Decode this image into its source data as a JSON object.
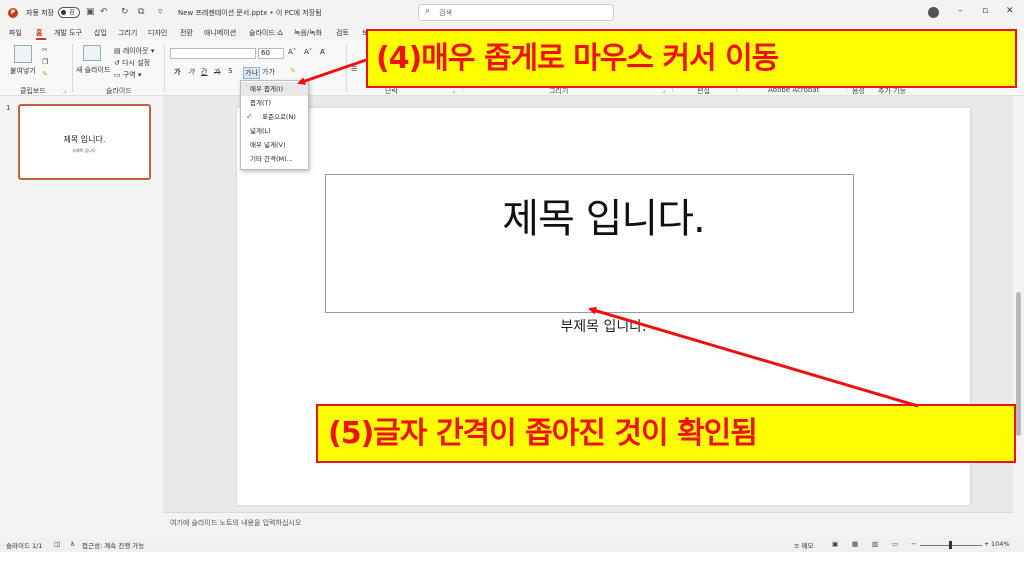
{
  "titlebar": {
    "autosave_label": "자동 저장",
    "toggle_state": "끔",
    "document_title": "New 프레젠테이션 문서.pptx • 이 PC에 저장됨",
    "search_placeholder": "검색"
  },
  "menu": {
    "tabs": [
      "파일",
      "홈",
      "개발 도구",
      "삽입",
      "그리기",
      "디자인",
      "전환",
      "애니메이션",
      "슬라이드 쇼",
      "녹음/녹화",
      "검토",
      "보"
    ],
    "active_tab": "홈"
  },
  "ribbon": {
    "paste_label": "붙여넣기",
    "new_slide_label": "새 슬라이드",
    "layout_label": "레이아웃",
    "reset_label": "다시 설정",
    "section_label": "구역",
    "clipboard_group": "클립보드",
    "slides_group": "슬라이드",
    "font_size": "60",
    "paragraph_group": "단락",
    "drawing_group": "그리기",
    "editing_group": "편집",
    "acrobat_group": "Adobe Acrobat",
    "voice_group": "음성",
    "addins_group": "추가 기능",
    "spacing_button": "가나"
  },
  "spacing_menu": {
    "items": [
      {
        "label": "매우 좁게(I)",
        "checked": false,
        "hover": true
      },
      {
        "label": "좁게(T)",
        "checked": false,
        "hover": false
      },
      {
        "label": "표준으로(N)",
        "checked": true,
        "hover": false
      },
      {
        "label": "넓게(L)",
        "checked": false,
        "hover": false
      },
      {
        "label": "매우 넓게(V)",
        "checked": false,
        "hover": false
      },
      {
        "label": "기타 간격(M)...",
        "checked": false,
        "hover": false
      }
    ]
  },
  "thumbnail": {
    "number": "1",
    "title": "제목 입니다.",
    "subtitle": "부제목 입니다."
  },
  "slide": {
    "title": "제목 입니다.",
    "subtitle": "부제목 입니다."
  },
  "notes": {
    "placeholder": "여기에 슬라이드 노트의 내용을 입력하십시오"
  },
  "status": {
    "slide_count": "슬라이드 1/1",
    "accessibility": "접근성: 계속 진행 가능",
    "notes_button": "메모",
    "zoom": "104%"
  },
  "annotations": {
    "step4": "(4)매우 좁게로 마우스 커서 이동",
    "step5": "(5)글자 간격이 좁아진 것이 확인됨",
    "color_fill": "#ffff00",
    "color_text": "#ee1111"
  }
}
